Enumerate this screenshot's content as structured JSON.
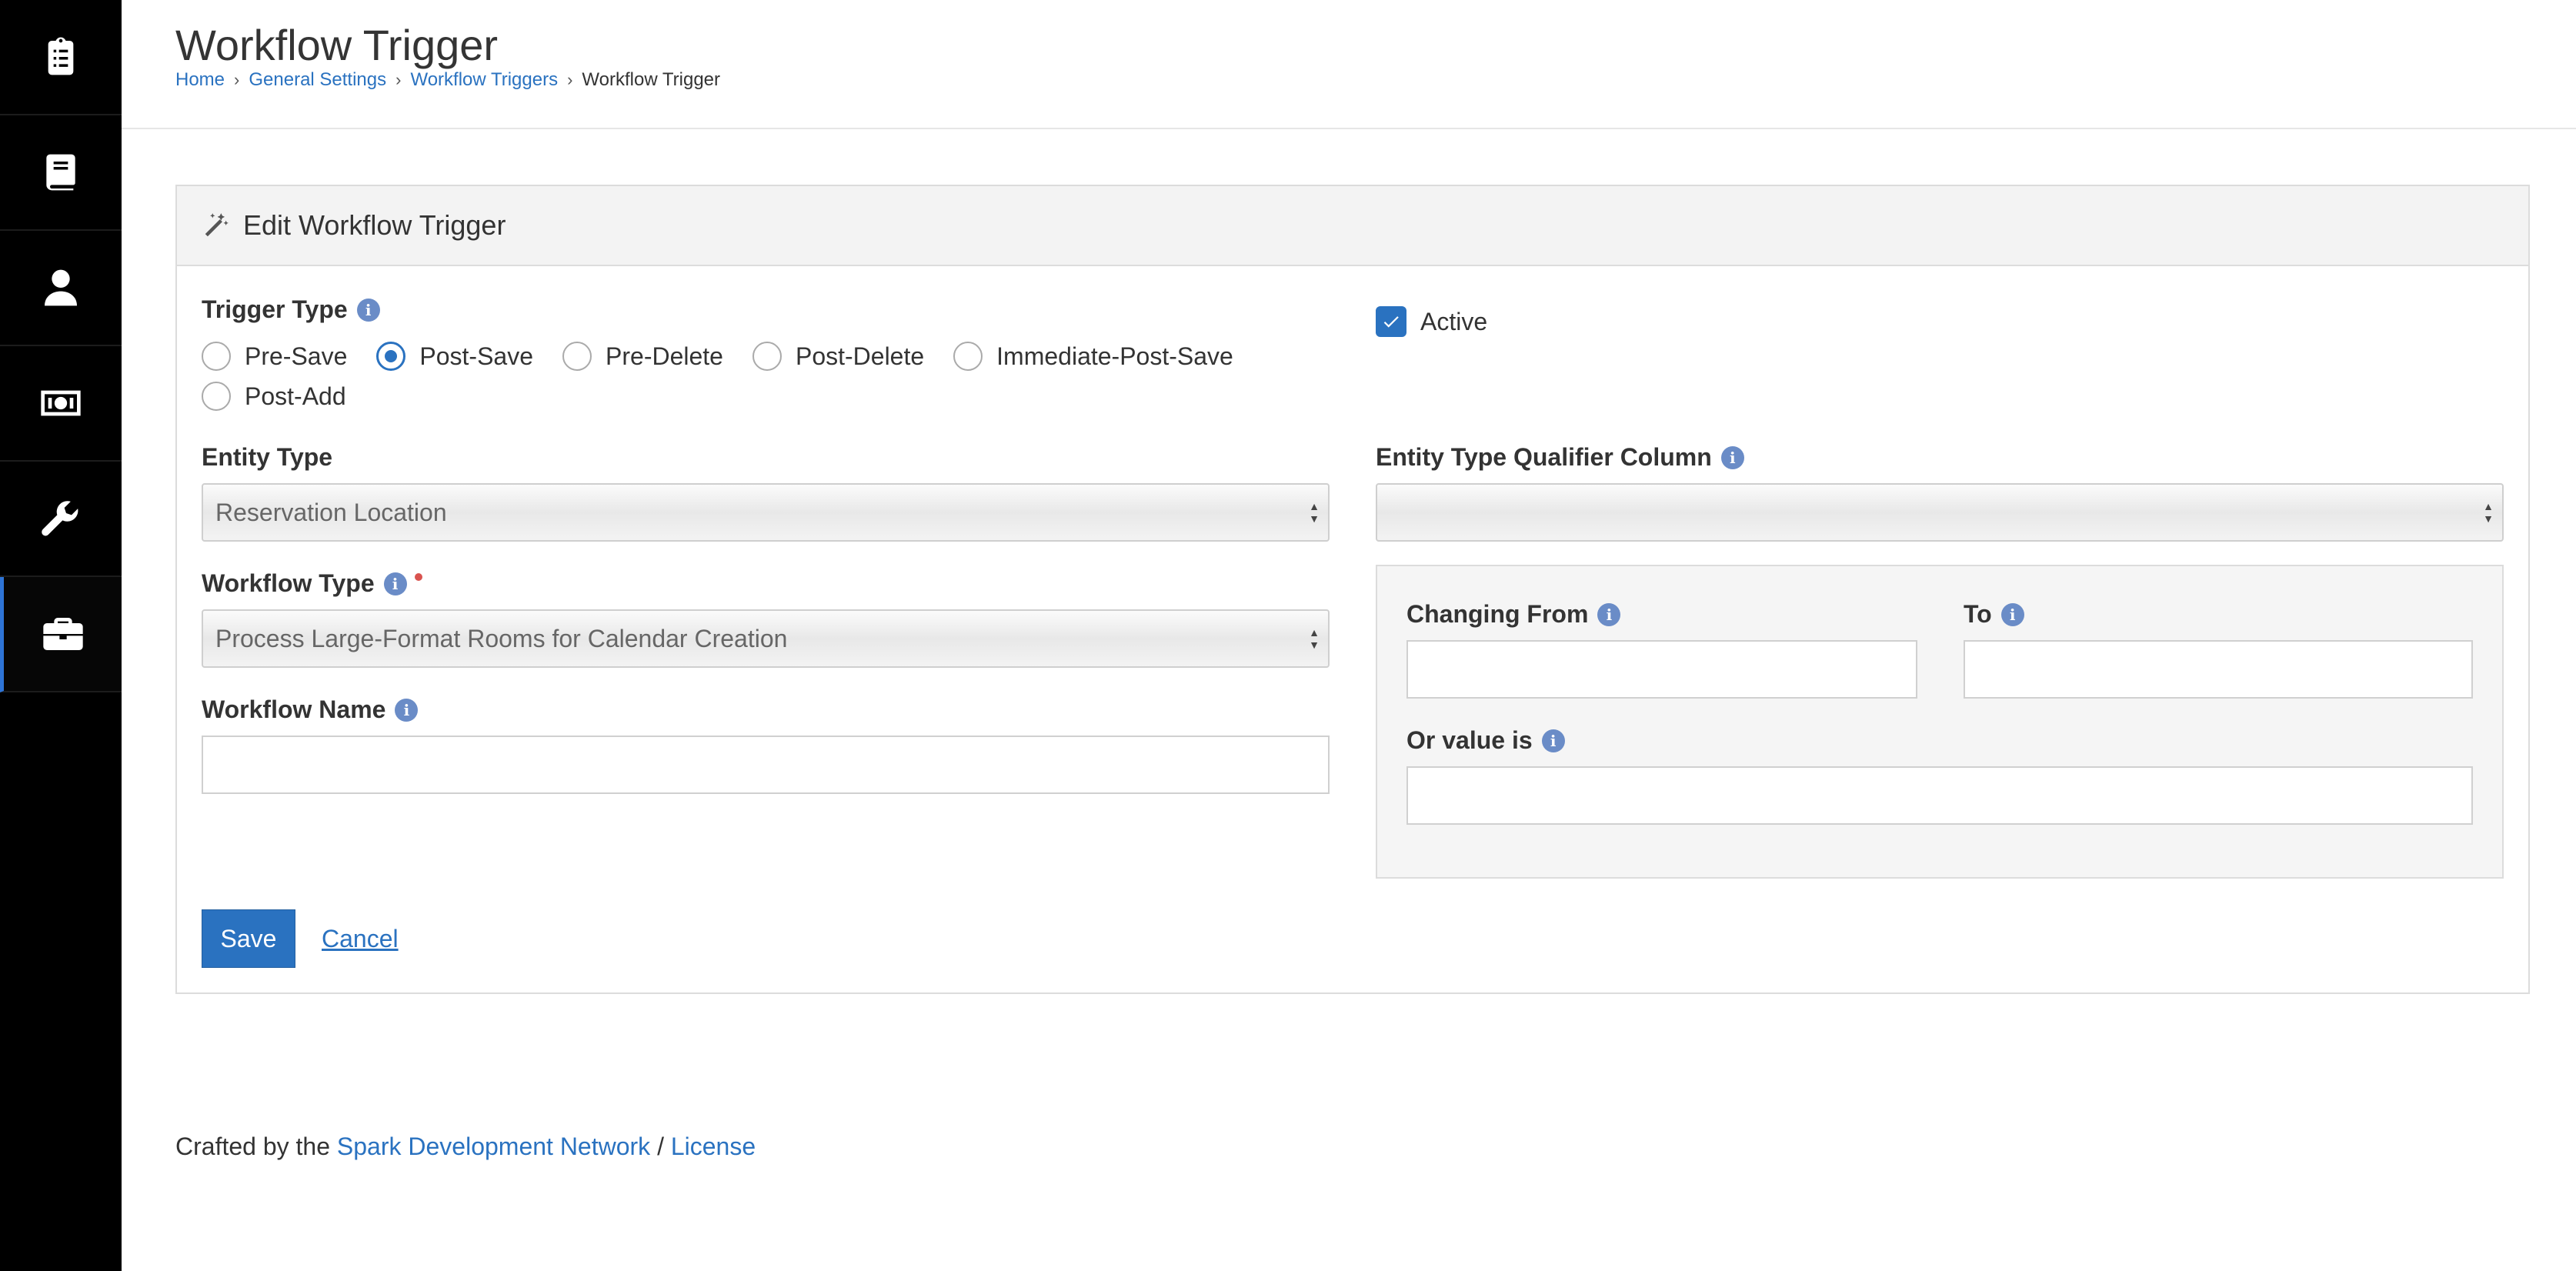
{
  "sidebar": {
    "items": [
      {
        "icon": "clipboard-list-icon",
        "active": false
      },
      {
        "icon": "book-icon",
        "active": false
      },
      {
        "icon": "user-icon",
        "active": false
      },
      {
        "icon": "money-bill-icon",
        "active": false
      },
      {
        "icon": "wrench-icon",
        "active": false
      },
      {
        "icon": "briefcase-icon",
        "active": true
      }
    ]
  },
  "header": {
    "title": "Workflow Trigger",
    "breadcrumb": [
      "Home",
      "General Settings",
      "Workflow Triggers",
      "Workflow Trigger"
    ]
  },
  "panel": {
    "title": "Edit Workflow Trigger",
    "trigger_type": {
      "label": "Trigger Type",
      "options": [
        "Pre-Save",
        "Post-Save",
        "Pre-Delete",
        "Post-Delete",
        "Immediate-Post-Save",
        "Post-Add"
      ],
      "selected": "Post-Save"
    },
    "active": {
      "label": "Active",
      "checked": true
    },
    "entity_type": {
      "label": "Entity Type",
      "value": "Reservation Location"
    },
    "entity_qualifier": {
      "label": "Entity Type Qualifier Column",
      "value": ""
    },
    "workflow_type": {
      "label": "Workflow Type",
      "value": "Process Large-Format Rooms for Calendar Creation",
      "required": true
    },
    "workflow_name": {
      "label": "Workflow Name",
      "value": ""
    },
    "changing_from": {
      "label": "Changing From",
      "value": ""
    },
    "to": {
      "label": "To",
      "value": ""
    },
    "or_value": {
      "label": "Or value is",
      "value": ""
    },
    "save_label": "Save",
    "cancel_label": "Cancel"
  },
  "footer": {
    "prefix": "Crafted by the",
    "org_link": "Spark Development Network",
    "separator": "/",
    "license_link": "License"
  },
  "colors": {
    "accent": "#2a72c0",
    "sidebar": "#000000",
    "info_icon": "#6a8cc7",
    "required": "#d9534f"
  }
}
